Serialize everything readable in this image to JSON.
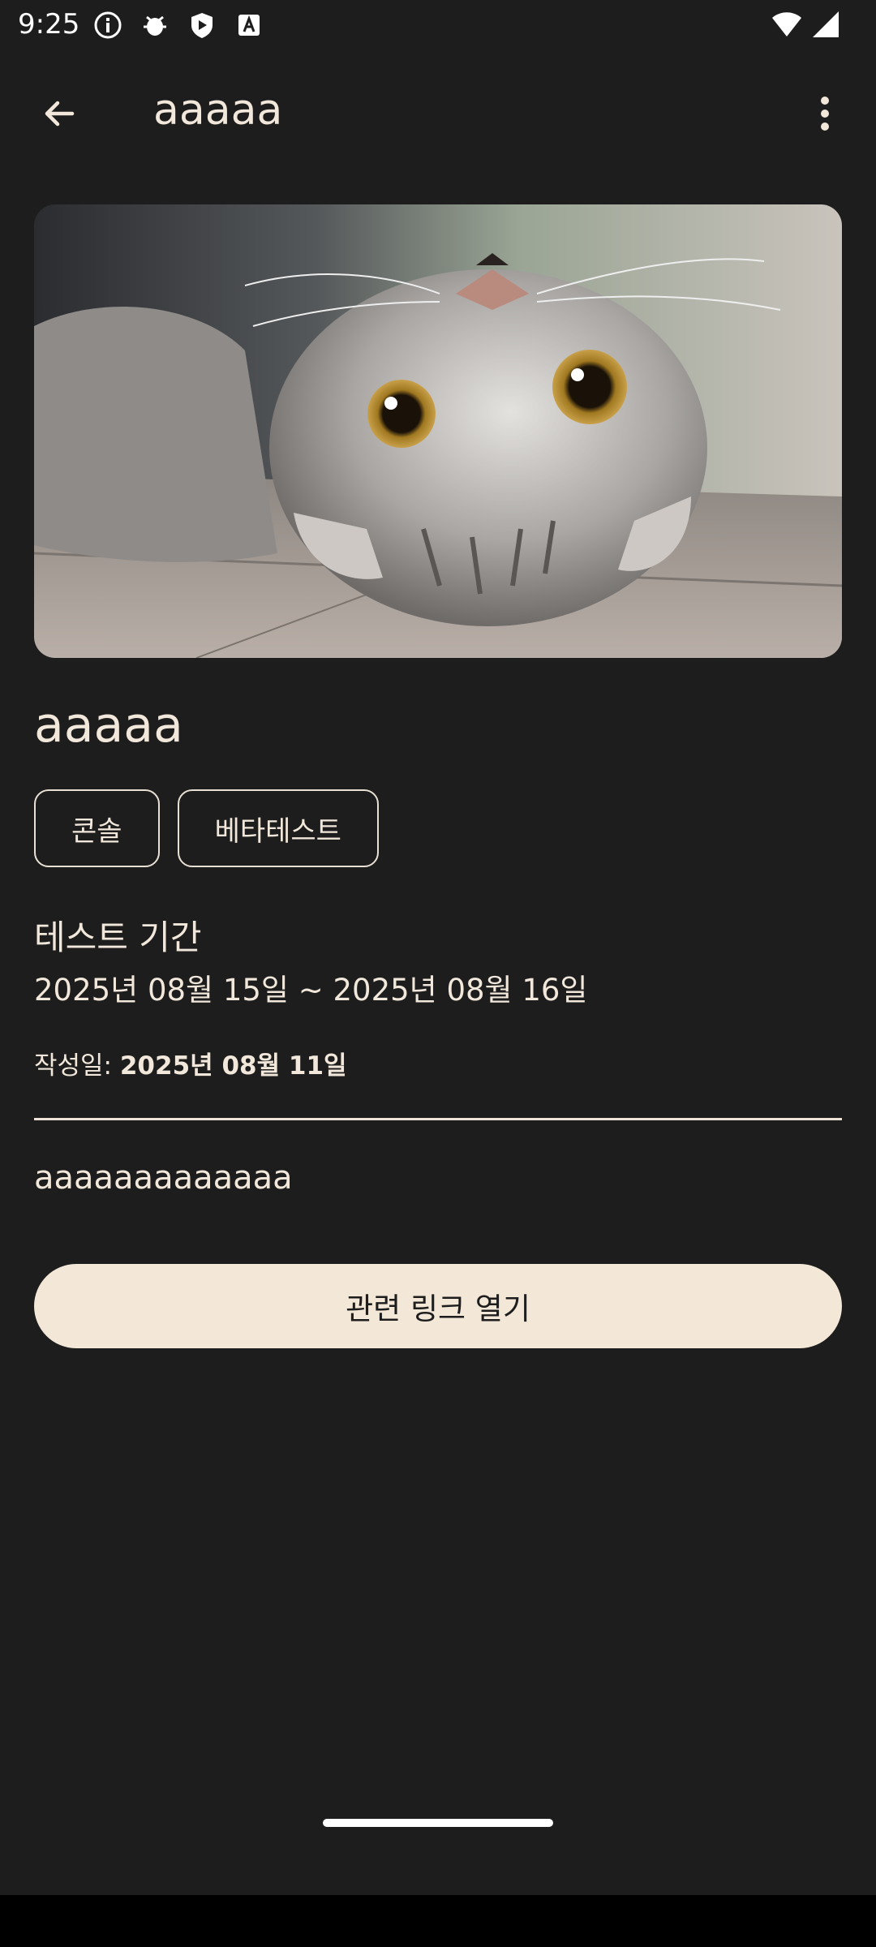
{
  "status_bar": {
    "time": "9:25",
    "icons": [
      "info-icon",
      "debug-bug-icon",
      "shield-icon",
      "font-a-icon",
      "wifi-icon",
      "signal-icon"
    ]
  },
  "app_bar": {
    "title": "aaaaa",
    "back_icon": "arrow-back-icon",
    "menu_icon": "more-vert-icon"
  },
  "post": {
    "image_subject": "cat",
    "title": "aaaaa",
    "tags": [
      "콘솔",
      "베타테스트"
    ],
    "period_label": "테스트 기간",
    "period_value": "2025년 08월 15일 ~ 2025년 08월 16일",
    "created_label": "작성일: ",
    "created_value": "2025년 08월 11일",
    "body": "aaaaaaaaaaaaa",
    "link_button_label": "관련 링크 열기"
  },
  "colors": {
    "background": "#1d1d1d",
    "text": "#f1e7da",
    "button_bg": "#f3e7d7"
  }
}
